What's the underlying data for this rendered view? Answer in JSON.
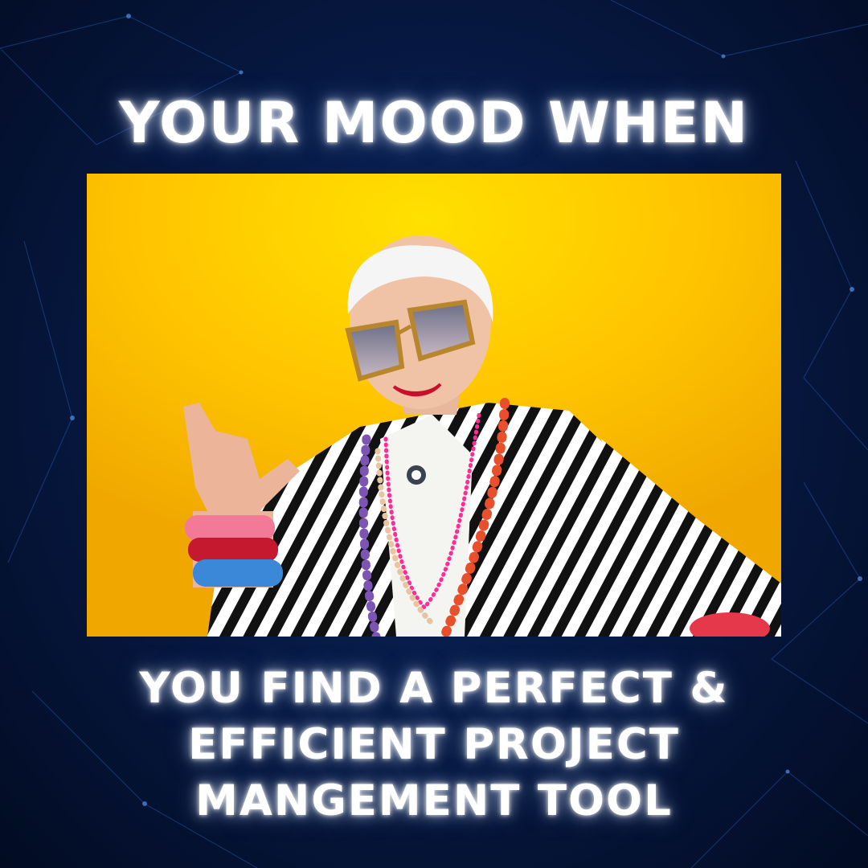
{
  "poster": {
    "headline_top": "YOUR MOOD WHEN",
    "headline_bottom": [
      "YOU FIND A PERFECT &",
      "EFFICIENT PROJECT",
      "MANGEMENT TOOL"
    ]
  },
  "colors": {
    "background": "#071a45",
    "photo_background": "#f5b400",
    "text": "#ffffff"
  }
}
